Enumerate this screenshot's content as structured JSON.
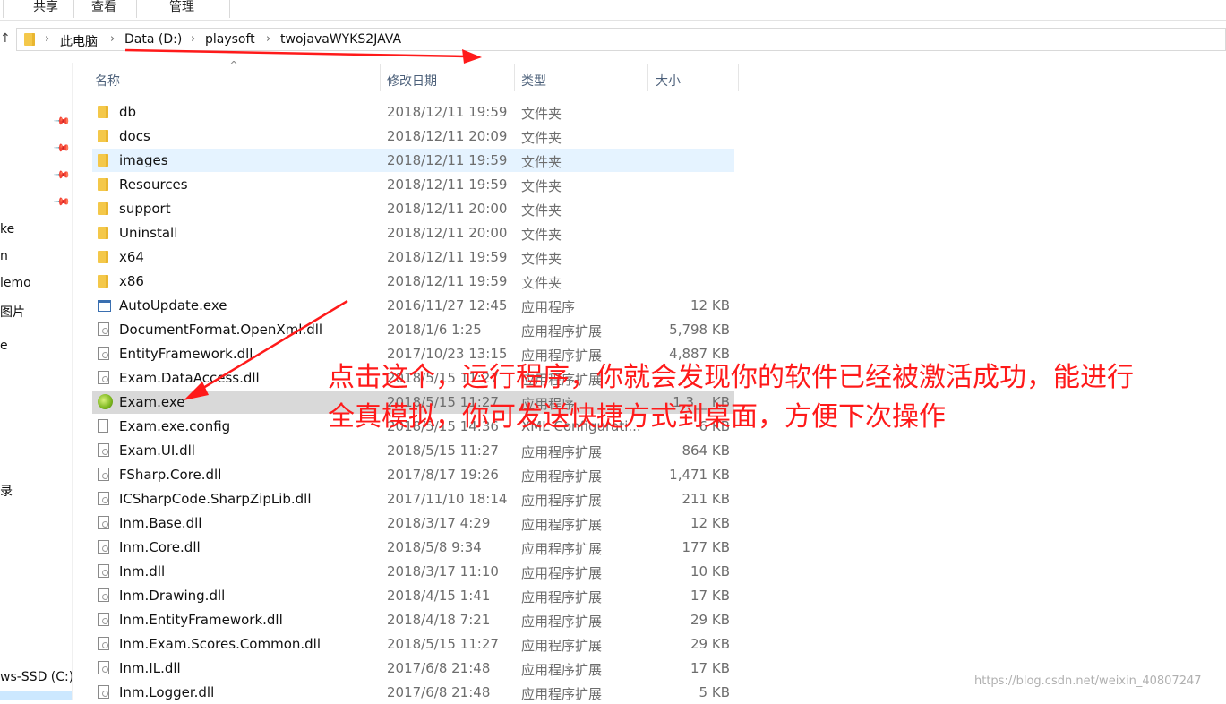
{
  "ribbon": {
    "tabs": [
      {
        "label": "共享"
      },
      {
        "label": "查看"
      },
      {
        "label": "管理"
      }
    ]
  },
  "nav": {
    "up_arrow": "↑",
    "breadcrumbs": [
      "此电脑",
      "Data (D:)",
      "playsoft",
      "twojavaWYKS2JAVA"
    ]
  },
  "navpane": {
    "items": [
      "ke",
      "n",
      "lemo",
      "图片",
      "e",
      "录",
      "ws-SSD (C:)"
    ]
  },
  "columns": {
    "name": "名称",
    "date": "修改日期",
    "type": "类型",
    "size": "大小"
  },
  "files": [
    {
      "name": "db",
      "date": "2018/12/11 19:59",
      "type": "文件夹",
      "size": "",
      "icon": "folder-icon"
    },
    {
      "name": "docs",
      "date": "2018/12/11 20:09",
      "type": "文件夹",
      "size": "",
      "icon": "folder-icon"
    },
    {
      "name": "images",
      "date": "2018/12/11 19:59",
      "type": "文件夹",
      "size": "",
      "icon": "folder-icon"
    },
    {
      "name": "Resources",
      "date": "2018/12/11 19:59",
      "type": "文件夹",
      "size": "",
      "icon": "folder-icon"
    },
    {
      "name": "support",
      "date": "2018/12/11 20:00",
      "type": "文件夹",
      "size": "",
      "icon": "folder-icon"
    },
    {
      "name": "Uninstall",
      "date": "2018/12/11 20:00",
      "type": "文件夹",
      "size": "",
      "icon": "folder-icon"
    },
    {
      "name": "x64",
      "date": "2018/12/11 19:59",
      "type": "文件夹",
      "size": "",
      "icon": "folder-icon"
    },
    {
      "name": "x86",
      "date": "2018/12/11 19:59",
      "type": "文件夹",
      "size": "",
      "icon": "folder-icon"
    },
    {
      "name": "AutoUpdate.exe",
      "date": "2016/11/27 12:45",
      "type": "应用程序",
      "size": "12 KB",
      "icon": "app-icon"
    },
    {
      "name": "DocumentFormat.OpenXml.dll",
      "date": "2018/1/6 1:25",
      "type": "应用程序扩展",
      "size": "5,798 KB",
      "icon": "dll-icon"
    },
    {
      "name": "EntityFramework.dll",
      "date": "2017/10/23 13:15",
      "type": "应用程序扩展",
      "size": "4,887 KB",
      "icon": "dll-icon"
    },
    {
      "name": "Exam.DataAccess.dll",
      "date": "2018/5/15 11:27",
      "type": "应用程序扩展",
      "size": "",
      "icon": "dll-icon"
    },
    {
      "name": "Exam.exe",
      "date": "2018/5/15 11:27",
      "type": "应用程序",
      "size": "1,3__ KB",
      "icon": "exam-exe-icon"
    },
    {
      "name": "Exam.exe.config",
      "date": "2018/5/15 14:36",
      "type": "XML Configurati...",
      "size": "6 KB",
      "icon": "file-icon"
    },
    {
      "name": "Exam.UI.dll",
      "date": "2018/5/15 11:27",
      "type": "应用程序扩展",
      "size": "864 KB",
      "icon": "dll-icon"
    },
    {
      "name": "FSharp.Core.dll",
      "date": "2017/8/17 19:26",
      "type": "应用程序扩展",
      "size": "1,471 KB",
      "icon": "dll-icon"
    },
    {
      "name": "ICSharpCode.SharpZipLib.dll",
      "date": "2017/11/10 18:14",
      "type": "应用程序扩展",
      "size": "211 KB",
      "icon": "dll-icon"
    },
    {
      "name": "Inm.Base.dll",
      "date": "2018/3/17 4:29",
      "type": "应用程序扩展",
      "size": "12 KB",
      "icon": "dll-icon"
    },
    {
      "name": "Inm.Core.dll",
      "date": "2018/5/8 9:34",
      "type": "应用程序扩展",
      "size": "177 KB",
      "icon": "dll-icon"
    },
    {
      "name": "Inm.dll",
      "date": "2018/3/17 11:10",
      "type": "应用程序扩展",
      "size": "10 KB",
      "icon": "dll-icon"
    },
    {
      "name": "Inm.Drawing.dll",
      "date": "2018/4/15 1:41",
      "type": "应用程序扩展",
      "size": "17 KB",
      "icon": "dll-icon"
    },
    {
      "name": "Inm.EntityFramework.dll",
      "date": "2018/4/18 7:21",
      "type": "应用程序扩展",
      "size": "29 KB",
      "icon": "dll-icon"
    },
    {
      "name": "Inm.Exam.Scores.Common.dll",
      "date": "2018/5/15 11:27",
      "type": "应用程序扩展",
      "size": "29 KB",
      "icon": "dll-icon"
    },
    {
      "name": "Inm.IL.dll",
      "date": "2017/6/8 21:48",
      "type": "应用程序扩展",
      "size": "17 KB",
      "icon": "dll-icon"
    },
    {
      "name": "Inm.Logger.dll",
      "date": "2017/6/8 21:48",
      "type": "应用程序扩展",
      "size": "5 KB",
      "icon": "dll-icon"
    }
  ],
  "annotation": {
    "line1": "点击这个，运行程序，你就会发现你的软件已经被激活成功，能进行",
    "line2": "全真模拟，你可发送快捷方式到桌面，方便下次操作"
  },
  "colors": {
    "annotation_red": "#ff1a1a",
    "hover_row": "#e5f3ff",
    "selected_row": "#d9d9d9"
  },
  "watermark": "https://blog.csdn.net/weixin_40807247"
}
